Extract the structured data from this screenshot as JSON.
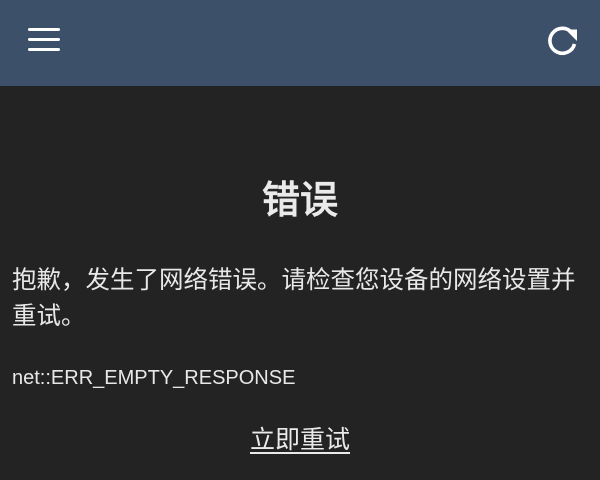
{
  "header": {
    "menu_icon": "hamburger-menu-icon",
    "refresh_icon": "refresh-icon",
    "background_color": "#3c5169"
  },
  "error": {
    "title": "错误",
    "message": "抱歉，发生了网络错误。请检查您设备的网络设置并重试。",
    "code": "net::ERR_EMPTY_RESPONSE",
    "retry_label": "立即重试"
  },
  "colors": {
    "background": "#232323",
    "text": "#eaeaea"
  }
}
